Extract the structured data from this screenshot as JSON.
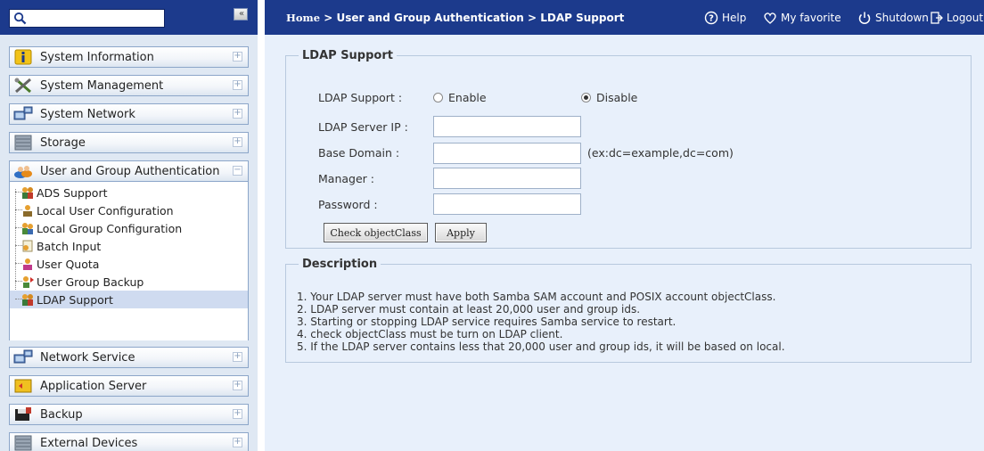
{
  "sidebar": {
    "search": {
      "placeholder": ""
    },
    "collapse_label": "«",
    "groups_top": [
      {
        "label": "System Information",
        "icon": "info-icon",
        "toggle": "+"
      },
      {
        "label": "System Management",
        "icon": "tools-icon",
        "toggle": "+"
      },
      {
        "label": "System Network",
        "icon": "network-icon",
        "toggle": "+"
      },
      {
        "label": "Storage",
        "icon": "storage-icon",
        "toggle": "+"
      },
      {
        "label": "User and Group Authentication",
        "icon": "users-icon",
        "toggle": "−"
      }
    ],
    "sub_items": [
      {
        "label": "ADS Support",
        "icon": "ads-icon"
      },
      {
        "label": "Local User Configuration",
        "icon": "local-user-icon"
      },
      {
        "label": "Local Group Configuration",
        "icon": "local-group-icon"
      },
      {
        "label": "Batch Input",
        "icon": "batch-input-icon"
      },
      {
        "label": "User Quota",
        "icon": "user-quota-icon"
      },
      {
        "label": "User Group Backup",
        "icon": "user-group-backup-icon"
      },
      {
        "label": "LDAP Support",
        "icon": "ldap-icon",
        "active": true
      }
    ],
    "groups_bottom": [
      {
        "label": "Network Service",
        "icon": "network-service-icon",
        "toggle": "+"
      },
      {
        "label": "Application Server",
        "icon": "app-server-icon",
        "toggle": "+"
      },
      {
        "label": "Backup",
        "icon": "backup-icon",
        "toggle": "+"
      },
      {
        "label": "External Devices",
        "icon": "external-devices-icon",
        "toggle": "+"
      }
    ]
  },
  "header": {
    "breadcrumb": {
      "home": "Home",
      "sep": " > ",
      "section": "User and Group Authentication",
      "page": "LDAP Support"
    },
    "help": "Help",
    "favorite": "My favorite",
    "shutdown": "Shutdown",
    "logout": "Logout"
  },
  "ldap_form": {
    "legend": "LDAP Support",
    "support_label": "LDAP Support :",
    "enable_label": "Enable",
    "disable_label": "Disable",
    "selected": "Disable",
    "server_ip_label": "LDAP Server IP :",
    "server_ip_value": "",
    "base_domain_label": "Base Domain :",
    "base_domain_value": "",
    "base_domain_hint": "(ex:dc=example,dc=com)",
    "manager_label": "Manager :",
    "manager_value": "",
    "password_label": "Password :",
    "password_value": "",
    "check_button": "Check objectClass",
    "apply_button": "Apply"
  },
  "description": {
    "legend": "Description",
    "lines": [
      "1. Your LDAP server must have both Samba SAM account and POSIX account objectClass.",
      "2. LDAP server must contain at least 20,000 user and group ids.",
      "3. Starting or stopping LDAP service requires Samba service to restart.",
      "4. check objectClass must be turn on LDAP client.",
      "5. If the LDAP server contains less that 20,000 user and group ids, it will be based on local."
    ]
  },
  "colors": {
    "topbar": "#1c3a8c",
    "sidebar_bg": "#dfe8f3",
    "main_bg": "#e8f0fb",
    "active_item": "#cfdbf0"
  }
}
